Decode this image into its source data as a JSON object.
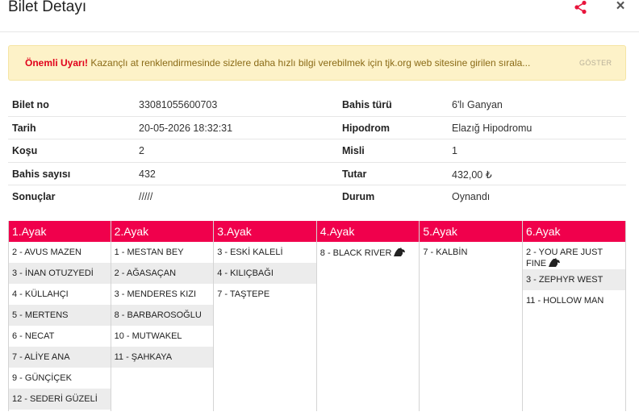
{
  "header": {
    "title": "Bilet Detayı",
    "share_icon": "share-icon",
    "close_label": "×"
  },
  "alert": {
    "strong": "Önemli Uyarı!",
    "text": "Kazançlı at renklendirmesinde sizlere daha hızlı bilgi verebilmek için tjk.org web sitesine girilen sırala...",
    "button": "GÖSTER"
  },
  "info": [
    {
      "l1": "Bilet no",
      "v1": "33081055600703",
      "l2": "Bahis türü",
      "v2": "6'lı Ganyan"
    },
    {
      "l1": "Tarih",
      "v1": "20-05-2026 18:32:31",
      "l2": "Hipodrom",
      "v2": "Elazığ Hipodromu"
    },
    {
      "l1": "Koşu",
      "v1": "2",
      "l2": "Misli",
      "v2": "1"
    },
    {
      "l1": "Bahis sayısı",
      "v1": "432",
      "l2": "Tutar",
      "v2": "432,00 ₺"
    },
    {
      "l1": "Sonuçlar",
      "v1": "/////",
      "l2": "Durum",
      "v2": "Oynandı"
    }
  ],
  "legs": [
    {
      "title": "1.Ayak",
      "horses": [
        "2 - AVUS MAZEN",
        "3 - İNAN OTUZYEDİ",
        "4 - KÜLLAHÇI",
        "5 - MERTENS",
        "6 - NECAT",
        "7 - ALİYE ANA",
        "9 - GÜNÇİÇEK",
        "12 - SEDERİ GÜZELİ"
      ]
    },
    {
      "title": "2.Ayak",
      "horses": [
        "1 - MESTAN BEY",
        "2 - AĞASAÇAN",
        "3 - MENDERES KIZI",
        "8 - BARBAROSOĞLU",
        "10 - MUTWAKEL",
        "11 - ŞAHKAYA"
      ]
    },
    {
      "title": "3.Ayak",
      "horses": [
        "3 - ESKİ KALELİ",
        "4 - KILIÇBAĞI",
        "7 - TAŞTEPE"
      ]
    },
    {
      "title": "4.Ayak",
      "horses": [
        "8 - BLACK RIVER"
      ]
    },
    {
      "title": "5.Ayak",
      "horses": [
        "7 - KALBİN"
      ]
    },
    {
      "title": "6.Ayak",
      "horses": [
        "2 - YOU ARE JUST FINE",
        "3 - ZEPHYR WEST",
        "11 - HOLLOW MAN"
      ]
    }
  ],
  "pony_icons": {
    "leg4_0": "pony-icon",
    "leg6_0": "pony-icon"
  },
  "colors": {
    "accent": "#f0004c",
    "alert_bg": "#fdf2c8",
    "alert_strong": "#e0001b"
  }
}
